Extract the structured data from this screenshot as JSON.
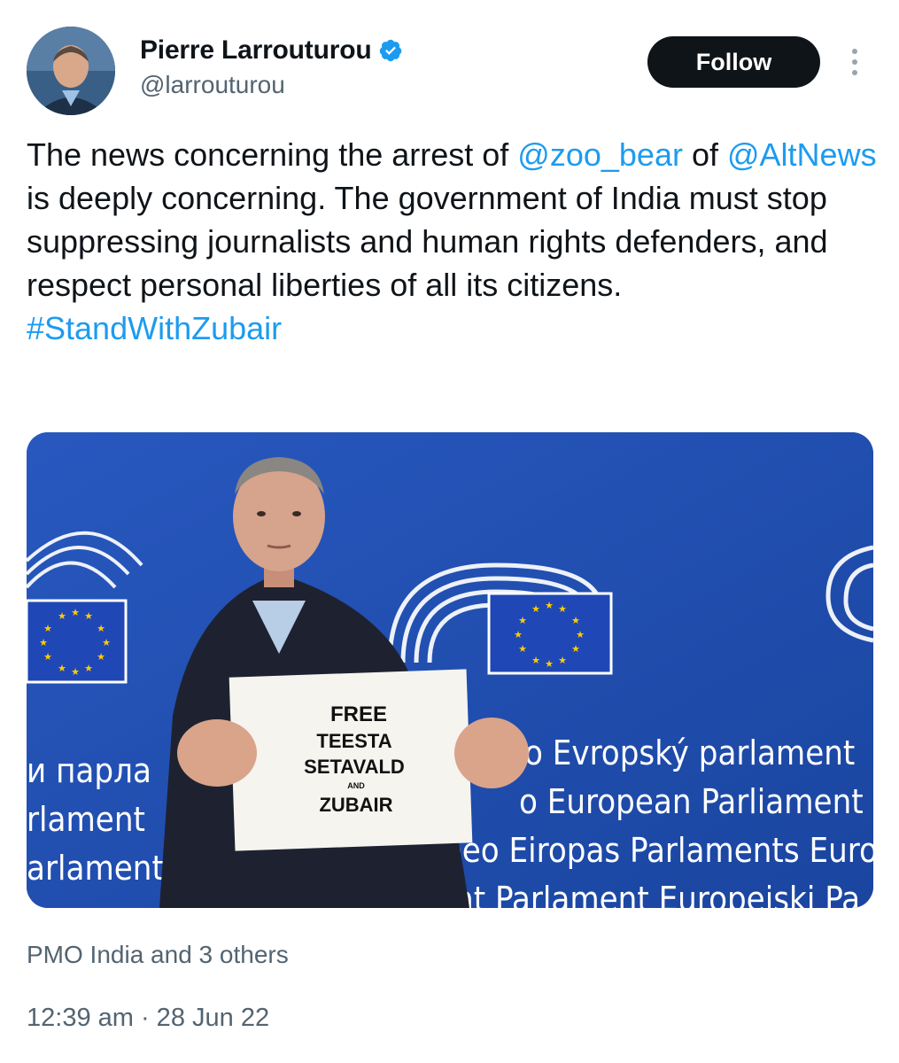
{
  "author": {
    "display_name": "Pierre Larrouturou",
    "handle": "@larrouturou",
    "verified_icon": "verified-badge-icon"
  },
  "actions": {
    "follow_label": "Follow",
    "more_icon": "more-vertical-icon"
  },
  "tweet": {
    "segments": [
      {
        "text": "The news concerning the arrest of ",
        "type": "text"
      },
      {
        "text": "@zoo_bear",
        "type": "mention"
      },
      {
        "text": " of ",
        "type": "text"
      },
      {
        "text": "@AltNews",
        "type": "mention"
      },
      {
        "text": " is deeply concerning. The government of India must stop suppressing journalists and human rights defenders, and respect personal liberties of all its citizens.",
        "type": "text"
      }
    ],
    "hashtag": "#StandWithZubair"
  },
  "media": {
    "sign_lines": [
      "FREE",
      "TEESTA",
      "SETAVALD",
      "AND",
      "ZUBAIR"
    ],
    "backdrop_lines": [
      "o  Evropský parlament",
      "o  European Parliament",
      "peo  Eiropas Parlaments  Europ",
      "ent  Parlament Europejski  Pa"
    ],
    "left_backdrop_lines": [
      "и парла",
      "rlament",
      "arlament  Parl"
    ],
    "colors": {
      "backdrop": "#1d4fb0",
      "flag_star": "#ffcc00"
    }
  },
  "engagement": {
    "liked_by": "PMO India and 3 others"
  },
  "meta": {
    "timestamp": "12:39 am · 28 Jun 22"
  }
}
